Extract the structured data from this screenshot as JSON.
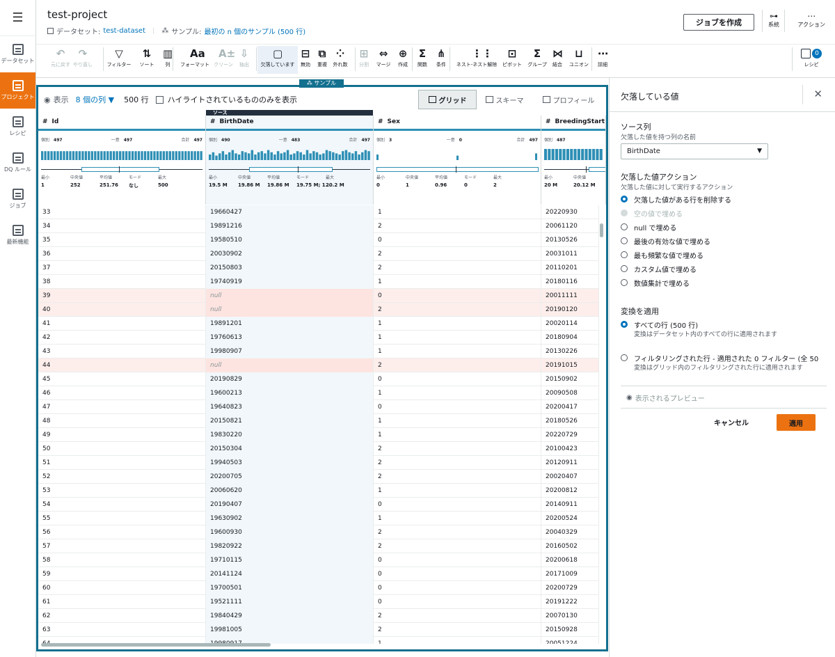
{
  "nav": {
    "menu_icon": "menu-icon",
    "items": [
      {
        "label": "データセット",
        "icon": "table-icon",
        "active": false
      },
      {
        "label": "プロジェクト",
        "icon": "project-icon",
        "active": true
      },
      {
        "label": "レシピ",
        "icon": "recipe-icon",
        "active": false
      },
      {
        "label": "DQ ルール",
        "icon": "dq-rules-icon",
        "active": false
      },
      {
        "label": "ジョブ",
        "icon": "job-icon",
        "active": false
      },
      {
        "label": "最新機能",
        "icon": "whats-new-icon",
        "active": false
      }
    ]
  },
  "header": {
    "project_title": "test-project",
    "dataset_prefix": "データセット:",
    "dataset_name": "test-dataset",
    "sample_prefix": "サンプル:",
    "sample_value": "最初の n 個のサンプル (500 行)",
    "create_job": "ジョブを作成",
    "lineage": "系統",
    "actions": "アクション"
  },
  "toolbar": {
    "items": [
      {
        "label": "元に戻す",
        "glyph": "↶",
        "disabled": true,
        "icon": "undo-icon"
      },
      {
        "label": "やり直し",
        "glyph": "↷",
        "disabled": true,
        "icon": "redo-icon"
      },
      {
        "label": "フィルター",
        "glyph": "▽",
        "disabled": false,
        "icon": "filter-icon"
      },
      {
        "label": "ソート",
        "glyph": "⇅",
        "disabled": false,
        "icon": "sort-icon"
      },
      {
        "label": "列",
        "glyph": "▥",
        "disabled": false,
        "icon": "column-icon"
      },
      {
        "label": "フォーマット",
        "glyph": "Aa",
        "disabled": false,
        "icon": "format-icon"
      },
      {
        "label": "クリーン",
        "glyph": "A±",
        "disabled": true,
        "icon": "clean-icon"
      },
      {
        "label": "抽出",
        "glyph": "⇩",
        "disabled": true,
        "icon": "extract-icon"
      },
      {
        "label": "欠落しています",
        "glyph": "▢",
        "disabled": false,
        "selected": true,
        "icon": "missing-icon"
      },
      {
        "label": "無効",
        "glyph": "⊟",
        "disabled": false,
        "icon": "invalid-icon"
      },
      {
        "label": "重複",
        "glyph": "⧉",
        "disabled": false,
        "icon": "duplicate-icon"
      },
      {
        "label": "外れ数",
        "glyph": "⁘",
        "disabled": false,
        "icon": "outlier-icon"
      },
      {
        "label": "分割",
        "glyph": "⊞",
        "disabled": true,
        "icon": "split-icon"
      },
      {
        "label": "マージ",
        "glyph": "⇔",
        "disabled": false,
        "icon": "merge-icon"
      },
      {
        "label": "作成",
        "glyph": "⊕",
        "disabled": false,
        "icon": "create-icon"
      },
      {
        "label": "関数",
        "glyph": "Σ",
        "disabled": false,
        "icon": "function-icon"
      },
      {
        "label": "条件",
        "glyph": "⋔",
        "disabled": false,
        "icon": "condition-icon"
      },
      {
        "label": "ネスト-ネスト解除",
        "glyph": "⋮⋮",
        "disabled": false,
        "icon": "nest-icon"
      },
      {
        "label": "ピボット",
        "glyph": "⊡",
        "disabled": false,
        "icon": "pivot-icon"
      },
      {
        "label": "グループ",
        "glyph": "Σ",
        "disabled": false,
        "icon": "group-icon"
      },
      {
        "label": "結合",
        "glyph": "⋈",
        "disabled": false,
        "icon": "join-icon"
      },
      {
        "label": "ユニオン",
        "glyph": "⊔",
        "disabled": false,
        "icon": "union-icon"
      },
      {
        "label": "詳細",
        "glyph": "⋯",
        "disabled": false,
        "icon": "more-icon"
      }
    ],
    "recipe_label": "レシピ",
    "recipe_count": "0"
  },
  "grid": {
    "sample_tag": "サンプル",
    "view_label": "表示",
    "columns_link": "8 個の列",
    "rows_count": "500 行",
    "highlight_label": "ハイライトされているもののみを表示",
    "tabs": [
      {
        "label": "グリッド",
        "active": true
      },
      {
        "label": "スキーマ",
        "active": false
      },
      {
        "label": "プロフィール",
        "active": false
      }
    ],
    "source_label": "ソース",
    "columns": [
      {
        "name": "Id",
        "selected": false,
        "distinct_label": "個別",
        "distinct": "497",
        "unique_label": "一意",
        "unique": "497",
        "total_label": "合計",
        "total": "497",
        "stats": [
          {
            "label": "最小",
            "value": "1"
          },
          {
            "label": "中央値",
            "value": "252"
          },
          {
            "label": "平均値",
            "value": "251.76"
          },
          {
            "label": "モード",
            "value": "なし"
          },
          {
            "label": "最大",
            "value": "500"
          }
        ]
      },
      {
        "name": "BirthDate",
        "selected": true,
        "distinct_label": "個別",
        "distinct": "490",
        "unique_label": "一意",
        "unique": "483",
        "total_label": "合計",
        "total": "497",
        "stats": [
          {
            "label": "最小",
            "value": "19.5 M"
          },
          {
            "label": "中央値",
            "value": "19.86 M"
          },
          {
            "label": "平均値",
            "value": "19.86 M"
          },
          {
            "label": "モード",
            "value": "19.75 M; 1..."
          },
          {
            "label": "最大",
            "value": "20.2 M"
          }
        ]
      },
      {
        "name": "Sex",
        "selected": false,
        "distinct_label": "個別",
        "distinct": "3",
        "unique_label": "一意",
        "unique": "0",
        "total_label": "合計",
        "total": "497",
        "stats": [
          {
            "label": "最小",
            "value": "0"
          },
          {
            "label": "中央値",
            "value": "1"
          },
          {
            "label": "平均値",
            "value": "0.96"
          },
          {
            "label": "モード",
            "value": "0"
          },
          {
            "label": "最大",
            "value": "2"
          }
        ]
      },
      {
        "name": "BreedingStart",
        "selected": false,
        "distinct_label": "個別",
        "distinct": "487",
        "unique_label": "",
        "unique": "",
        "total_label": "",
        "total": "",
        "stats": [
          {
            "label": "最小",
            "value": "20 M"
          },
          {
            "label": "中央値",
            "value": "20.12 M"
          }
        ]
      }
    ],
    "rows": [
      {
        "id": "33",
        "birth": "19660427",
        "sex": "1",
        "breed": "20220930",
        "deleted": false
      },
      {
        "id": "34",
        "birth": "19891216",
        "sex": "2",
        "breed": "20061120",
        "deleted": false
      },
      {
        "id": "35",
        "birth": "19580510",
        "sex": "0",
        "breed": "20130526",
        "deleted": false
      },
      {
        "id": "36",
        "birth": "20030902",
        "sex": "2",
        "breed": "20031011",
        "deleted": false
      },
      {
        "id": "37",
        "birth": "20150803",
        "sex": "2",
        "breed": "20110201",
        "deleted": false
      },
      {
        "id": "38",
        "birth": "19740919",
        "sex": "1",
        "breed": "20180116",
        "deleted": false
      },
      {
        "id": "39",
        "birth": "null",
        "sex": "0",
        "breed": "20011111",
        "deleted": true
      },
      {
        "id": "40",
        "birth": "null",
        "sex": "2",
        "breed": "20190120",
        "deleted": true
      },
      {
        "id": "41",
        "birth": "19891201",
        "sex": "1",
        "breed": "20020114",
        "deleted": false
      },
      {
        "id": "42",
        "birth": "19760613",
        "sex": "1",
        "breed": "20180904",
        "deleted": false
      },
      {
        "id": "43",
        "birth": "19980907",
        "sex": "1",
        "breed": "20130226",
        "deleted": false
      },
      {
        "id": "44",
        "birth": "null",
        "sex": "2",
        "breed": "20191015",
        "deleted": true
      },
      {
        "id": "45",
        "birth": "20190829",
        "sex": "0",
        "breed": "20150902",
        "deleted": false
      },
      {
        "id": "46",
        "birth": "19600213",
        "sex": "1",
        "breed": "20090508",
        "deleted": false
      },
      {
        "id": "47",
        "birth": "19640823",
        "sex": "0",
        "breed": "20200417",
        "deleted": false
      },
      {
        "id": "48",
        "birth": "20150821",
        "sex": "1",
        "breed": "20180526",
        "deleted": false
      },
      {
        "id": "49",
        "birth": "19830220",
        "sex": "1",
        "breed": "20220729",
        "deleted": false
      },
      {
        "id": "50",
        "birth": "20150304",
        "sex": "2",
        "breed": "20100423",
        "deleted": false
      },
      {
        "id": "51",
        "birth": "19940503",
        "sex": "2",
        "breed": "20120911",
        "deleted": false
      },
      {
        "id": "52",
        "birth": "20200705",
        "sex": "2",
        "breed": "20020407",
        "deleted": false
      },
      {
        "id": "53",
        "birth": "20060620",
        "sex": "1",
        "breed": "20200812",
        "deleted": false
      },
      {
        "id": "54",
        "birth": "20190407",
        "sex": "0",
        "breed": "20140911",
        "deleted": false
      },
      {
        "id": "55",
        "birth": "19630902",
        "sex": "1",
        "breed": "20200524",
        "deleted": false
      },
      {
        "id": "56",
        "birth": "19600930",
        "sex": "2",
        "breed": "20040329",
        "deleted": false
      },
      {
        "id": "57",
        "birth": "19820922",
        "sex": "2",
        "breed": "20160502",
        "deleted": false
      },
      {
        "id": "58",
        "birth": "19710115",
        "sex": "0",
        "breed": "20200618",
        "deleted": false
      },
      {
        "id": "59",
        "birth": "20141124",
        "sex": "0",
        "breed": "20171009",
        "deleted": false
      },
      {
        "id": "60",
        "birth": "19700501",
        "sex": "0",
        "breed": "20200729",
        "deleted": false
      },
      {
        "id": "61",
        "birth": "19521111",
        "sex": "0",
        "breed": "20191222",
        "deleted": false
      },
      {
        "id": "62",
        "birth": "19840429",
        "sex": "2",
        "breed": "20070130",
        "deleted": false
      },
      {
        "id": "63",
        "birth": "19981005",
        "sex": "2",
        "breed": "20150928",
        "deleted": false
      },
      {
        "id": "64",
        "birth": "19980917",
        "sex": "1",
        "breed": "20051224",
        "deleted": false
      }
    ]
  },
  "panel": {
    "title": "欠落している値",
    "source_col_title": "ソース列",
    "source_col_desc": "欠落した値を持つ列の名前",
    "source_col_value": "BirthDate",
    "action_title": "欠落した値アクション",
    "action_desc": "欠落した値に対して実行するアクション",
    "actions": [
      {
        "label": "欠落した値がある行を削除する",
        "checked": true,
        "disabled": false
      },
      {
        "label": "空の値で埋める",
        "checked": false,
        "disabled": true
      },
      {
        "label": "null で埋める",
        "checked": false,
        "disabled": false
      },
      {
        "label": "最後の有効な値で埋める",
        "checked": false,
        "disabled": false
      },
      {
        "label": "最も頻繁な値で埋める",
        "checked": false,
        "disabled": false
      },
      {
        "label": "カスタム値で埋める",
        "checked": false,
        "disabled": false
      },
      {
        "label": "数値集計で埋める",
        "checked": false,
        "disabled": false
      }
    ],
    "apply_title": "変換を適用",
    "apply_opts": [
      {
        "label": "すべての行 (500 行)",
        "sub": "変換はデータセット内のすべての行に適用されます",
        "checked": true
      },
      {
        "label": "フィルタリングされた行 - 適用された 0 フィルター (全 50",
        "sub": "変換はグリッド内のフィルタリングされた行に適用されます",
        "checked": false
      }
    ],
    "preview": "表示されるプレビュー",
    "cancel": "キャンセル",
    "apply": "適用"
  }
}
